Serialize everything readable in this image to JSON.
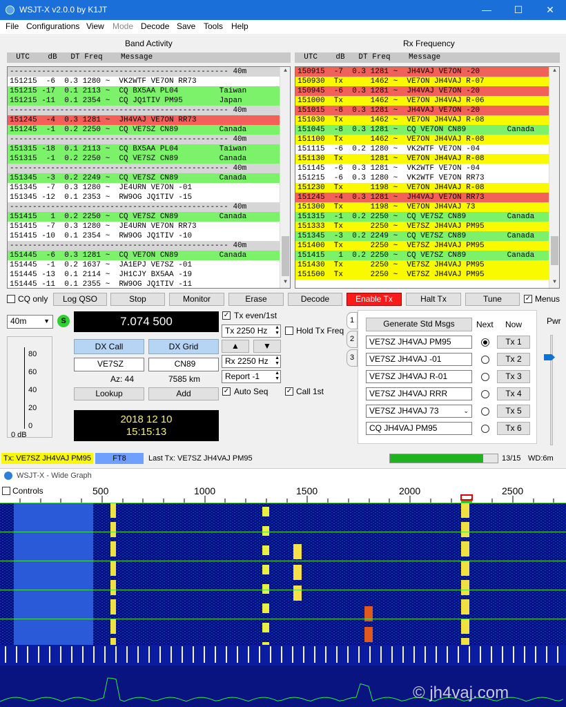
{
  "window": {
    "title": "WSJT-X   v2.0.0   by K1JT",
    "minimize": "—",
    "maximize": "☐",
    "close": "✕"
  },
  "menu": [
    "File",
    "Configurations",
    "View",
    "Mode",
    "Decode",
    "Save",
    "Tools",
    "Help"
  ],
  "band_activity": {
    "title": "Band Activity",
    "header": "  UTC    dB   DT Freq    Message",
    "rows": [
      {
        "t": "------------------------------------------------ 40m",
        "c": "s"
      },
      {
        "t": "151215  -6  0.3 1280 ~  VK2WTF VE7ON RR73",
        "c": "w"
      },
      {
        "t": "151215 -17  0.1 2113 ~  CQ BX5AA PL04         Taiwan",
        "c": "g"
      },
      {
        "t": "151215 -11  0.1 2354 ~  CQ JQ1TIV PM95        Japan",
        "c": "g"
      },
      {
        "t": "------------------------------------------------ 40m",
        "c": "s"
      },
      {
        "t": "151245  -4  0.3 1281 ~  JH4VAJ VE7ON RR73",
        "c": "r"
      },
      {
        "t": "151245  -1  0.2 2250 ~  CQ VE7SZ CN89         Canada",
        "c": "g"
      },
      {
        "t": "------------------------------------------------ 40m",
        "c": "s"
      },
      {
        "t": "151315 -18  0.1 2113 ~  CQ BX5AA PL04         Taiwan",
        "c": "g"
      },
      {
        "t": "151315  -1  0.2 2250 ~  CQ VE7SZ CN89         Canada",
        "c": "g"
      },
      {
        "t": "------------------------------------------------ 40m",
        "c": "s"
      },
      {
        "t": "151345  -3  0.2 2249 ~  CQ VE7SZ CN89         Canada",
        "c": "g"
      },
      {
        "t": "151345  -7  0.3 1280 ~  JE4URN VE7ON -01",
        "c": "w"
      },
      {
        "t": "151345 -12  0.1 2353 ~  RW9OG JQ1TIV -15",
        "c": "w"
      },
      {
        "t": "------------------------------------------------ 40m",
        "c": "s"
      },
      {
        "t": "151415   1  0.2 2250 ~  CQ VE7SZ CN89         Canada",
        "c": "g"
      },
      {
        "t": "151415  -7  0.3 1280 ~  JE4URN VE7ON RR73",
        "c": "w"
      },
      {
        "t": "151415 -10  0.1 2354 ~  RW9OG JQ1TIV -10",
        "c": "w"
      },
      {
        "t": "------------------------------------------------ 40m",
        "c": "s"
      },
      {
        "t": "151445  -6  0.3 1281 ~  CQ VE7ON CN89         Canada",
        "c": "g"
      },
      {
        "t": "151445  -1  0.2 1637 ~  JA1EPJ VE7SZ -01",
        "c": "w"
      },
      {
        "t": "151445 -13  0.1 2114 ~  JH1CJY BX5AA -19",
        "c": "w"
      },
      {
        "t": "151445 -11  0.1 2355 ~  RW9OG JQ1TIV -11",
        "c": "w"
      }
    ]
  },
  "rx_frequency": {
    "title": "Rx Frequency",
    "header": "  UTC    dB   DT Freq    Message",
    "rows": [
      {
        "t": "150915  -7  0.3 1281 ~  JH4VAJ VE7ON -20",
        "c": "r"
      },
      {
        "t": "150930  Tx      1462 ~  VE7ON JH4VAJ R-07",
        "c": "y"
      },
      {
        "t": "150945  -6  0.3 1281 ~  JH4VAJ VE7ON -20",
        "c": "r"
      },
      {
        "t": "151000  Tx      1462 ~  VE7ON JH4VAJ R-06",
        "c": "y"
      },
      {
        "t": "151015  -8  0.3 1281 ~  JH4VAJ VE7ON -20",
        "c": "r"
      },
      {
        "t": "151030  Tx      1462 ~  VE7ON JH4VAJ R-08",
        "c": "y"
      },
      {
        "t": "151045  -8  0.3 1281 ~  CQ VE7ON CN89         Canada",
        "c": "g"
      },
      {
        "t": "151100  Tx      1462 ~  VE7ON JH4VAJ R-08",
        "c": "y"
      },
      {
        "t": "151115  -6  0.2 1280 ~  VK2WTF VE7ON -04",
        "c": "w"
      },
      {
        "t": "151130  Tx      1281 ~  VE7ON JH4VAJ R-08",
        "c": "y"
      },
      {
        "t": "151145  -6  0.3 1281 ~  VK2WTF VE7ON -04",
        "c": "w"
      },
      {
        "t": "151215  -6  0.3 1280 ~  VK2WTF VE7ON RR73",
        "c": "w"
      },
      {
        "t": "151230  Tx      1198 ~  VE7ON JH4VAJ R-08",
        "c": "y"
      },
      {
        "t": "151245  -4  0.3 1281 ~  JH4VAJ VE7ON RR73",
        "c": "r"
      },
      {
        "t": "151300  Tx      1198 ~  VE7ON JH4VAJ 73",
        "c": "y"
      },
      {
        "t": "151315  -1  0.2 2250 ~  CQ VE7SZ CN89         Canada",
        "c": "g"
      },
      {
        "t": "151333  Tx      2250 ~  VE7SZ JH4VAJ PM95",
        "c": "y"
      },
      {
        "t": "151345  -3  0.2 2249 ~  CQ VE7SZ CN89         Canada",
        "c": "g"
      },
      {
        "t": "151400  Tx      2250 ~  VE7SZ JH4VAJ PM95",
        "c": "y"
      },
      {
        "t": "151415   1  0.2 2250 ~  CQ VE7SZ CN89         Canada",
        "c": "g"
      },
      {
        "t": "151430  Tx      2250 ~  VE7SZ JH4VAJ PM95",
        "c": "y"
      },
      {
        "t": "151500  Tx      2250 ~  VE7SZ JH4VAJ PM95",
        "c": "y"
      }
    ]
  },
  "buttons": {
    "cq_only": "CQ only",
    "log_qso": "Log QSO",
    "stop": "Stop",
    "monitor": "Monitor",
    "erase": "Erase",
    "decode": "Decode",
    "enable_tx": "Enable Tx",
    "halt_tx": "Halt Tx",
    "tune": "Tune",
    "menus": "Menus"
  },
  "band": "40m",
  "freq_display": "7.074 500",
  "dx": {
    "call_label": "DX Call",
    "grid_label": "DX Grid",
    "call": "VE7SZ",
    "grid": "CN89",
    "az": "Az: 44",
    "dist": "7585 km",
    "lookup": "Lookup",
    "add": "Add"
  },
  "clock": {
    "date": "2018 12 10",
    "time": "15:15:13"
  },
  "meter": {
    "ticks": [
      "80",
      "60",
      "40",
      "20",
      "0"
    ],
    "value": "0 dB"
  },
  "tx_controls": {
    "tx_even": "Tx even/1st",
    "tx_freq": "Tx  2250  Hz",
    "hold_tx": "Hold Tx Freq",
    "rx_freq": "Rx  2250  Hz",
    "report": "Report -1",
    "auto_seq": "Auto Seq",
    "call_1st": "Call 1st",
    "up": "▲",
    "down": "▼"
  },
  "msgs": {
    "tabs": [
      "1",
      "2",
      "3"
    ],
    "gen": "Generate Std Msgs",
    "next": "Next",
    "now": "Now",
    "items": [
      "VE7SZ JH4VAJ PM95",
      "VE7SZ JH4VAJ -01",
      "VE7SZ JH4VAJ R-01",
      "VE7SZ JH4VAJ RRR",
      "VE7SZ JH4VAJ 73",
      "CQ JH4VAJ PM95"
    ],
    "tx": [
      "Tx 1",
      "Tx 2",
      "Tx 3",
      "Tx 4",
      "Tx 5",
      "Tx 6"
    ]
  },
  "pwr": "Pwr",
  "status": {
    "tx": "Tx: VE7SZ JH4VAJ PM95",
    "mode": "FT8",
    "last_tx": "Last Tx: VE7SZ JH4VAJ PM95",
    "progress": 0.8667,
    "count": "13/15",
    "wd": "WD:6m"
  },
  "wide": {
    "title": "WSJT-X - Wide Graph",
    "controls": "Controls",
    "scale": [
      "500",
      "1000",
      "1500",
      "2000",
      "2500"
    ]
  },
  "watermark": "© jh4vaj.com",
  "colors": {
    "green": "#7cf26a",
    "red": "#f3605a",
    "yellow": "#f9f900",
    "sep": "#d6d6d6",
    "enable_tx": "#ff1a1a",
    "progress": "#1fb31f",
    "waterfall": "#07127a"
  }
}
